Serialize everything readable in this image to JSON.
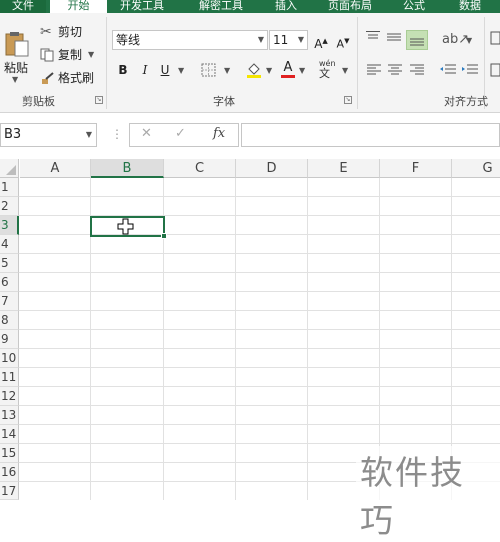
{
  "ribbon_tabs": [
    "文件",
    "开始",
    "开发工具",
    "解密工具",
    "插入",
    "页面布局",
    "公式",
    "数据"
  ],
  "clipboard": {
    "paste": "粘贴",
    "cut": "剪切",
    "copy": "复制",
    "format_painter": "格式刷",
    "group_label": "剪贴板"
  },
  "font": {
    "name": "等线",
    "size": "11",
    "bold": "B",
    "italic": "I",
    "underline": "U",
    "phonetic": "wén",
    "group_label": "字体"
  },
  "alignment": {
    "group_label": "对齐方式"
  },
  "formula_bar": {
    "name_box": "B3",
    "cancel": "✕",
    "enter": "✓",
    "fx": "fx",
    "content": ""
  },
  "columns": [
    "A",
    "B",
    "C",
    "D",
    "E",
    "F",
    "G"
  ],
  "rows": [
    "1",
    "2",
    "3",
    "4",
    "5",
    "6",
    "7",
    "8",
    "9",
    "10",
    "11",
    "12",
    "13",
    "14",
    "15",
    "16",
    "17"
  ],
  "selected_cell": "B3",
  "watermark": "软件技巧",
  "colors": {
    "accent": "#217346",
    "grid": "#e1e1e1",
    "header_bg": "#f3f3f3"
  }
}
